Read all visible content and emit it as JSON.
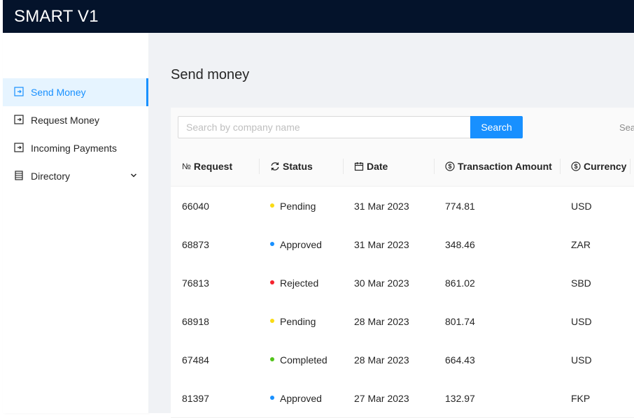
{
  "app": {
    "title": "SMART V1"
  },
  "sidebar": {
    "items": [
      {
        "label": "Send Money",
        "icon": "send-icon",
        "active": true
      },
      {
        "label": "Request Money",
        "icon": "request-icon",
        "active": false
      },
      {
        "label": "Incoming Payments",
        "icon": "incoming-icon",
        "active": false
      },
      {
        "label": "Directory",
        "icon": "directory-icon",
        "active": false,
        "expandable": true
      }
    ]
  },
  "page": {
    "title": "Send money"
  },
  "search": {
    "placeholder": "Search by company name",
    "button_label": "Search",
    "right_text": "Sea"
  },
  "table": {
    "columns": [
      {
        "label": "Request",
        "icon": "number-sign-icon",
        "icon_text": "№"
      },
      {
        "label": "Status",
        "icon": "sync-icon"
      },
      {
        "label": "Date",
        "icon": "calendar-icon"
      },
      {
        "label": "Transaction Amount",
        "icon": "dollar-circle-icon"
      },
      {
        "label": "Currency",
        "icon": "dollar-circle-icon"
      }
    ],
    "rows": [
      {
        "request": "66040",
        "status": "Pending",
        "date": "31 Mar 2023",
        "amount": "774.81",
        "currency": "USD"
      },
      {
        "request": "68873",
        "status": "Approved",
        "date": "31 Mar 2023",
        "amount": "348.46",
        "currency": "ZAR"
      },
      {
        "request": "76813",
        "status": "Rejected",
        "date": "30 Mar 2023",
        "amount": "861.02",
        "currency": "SBD"
      },
      {
        "request": "68918",
        "status": "Pending",
        "date": "28 Mar 2023",
        "amount": "801.74",
        "currency": "USD"
      },
      {
        "request": "67484",
        "status": "Completed",
        "date": "28 Mar 2023",
        "amount": "664.43",
        "currency": "USD"
      },
      {
        "request": "81397",
        "status": "Approved",
        "date": "27 Mar 2023",
        "amount": "132.97",
        "currency": "FKP"
      }
    ]
  },
  "status_colors": {
    "Pending": "#fadb14",
    "Approved": "#1890ff",
    "Rejected": "#f5222d",
    "Completed": "#52c41a"
  },
  "colors": {
    "accent": "#1890ff",
    "header_bg": "#04132b"
  }
}
